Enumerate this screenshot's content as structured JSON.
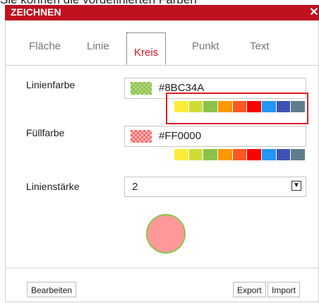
{
  "caption": "Sie können die vordefinierten Farben",
  "dialog": {
    "title": "ZEICHNEN",
    "close_label": "✕"
  },
  "tabs": [
    {
      "label": "Fläche"
    },
    {
      "label": "Linie"
    },
    {
      "label": "Kreis",
      "active": true
    },
    {
      "label": "Punkt"
    },
    {
      "label": "Text"
    }
  ],
  "line_color": {
    "label": "Linienfarbe",
    "value": "#8BC34A"
  },
  "fill_color": {
    "label": "Füllfarbe",
    "value": "#FF0000"
  },
  "palette": [
    "#FFEB3B",
    "#CDDC39",
    "#8BC34A",
    "#FF9800",
    "#FF5722",
    "#FF0000",
    "#2196F3",
    "#3F51B5",
    "#607D8B"
  ],
  "line_width": {
    "label": "Linienstärke",
    "value": "2"
  },
  "preview": {
    "fill": "#FF9999",
    "stroke": "#8BC34A"
  },
  "buttons": {
    "edit": "Bearbeiten",
    "export": "Export",
    "import": "Import"
  },
  "colors": {
    "title_bar": "#C0111F",
    "active_tab": "#D8101E",
    "highlight": "#E01D25"
  }
}
